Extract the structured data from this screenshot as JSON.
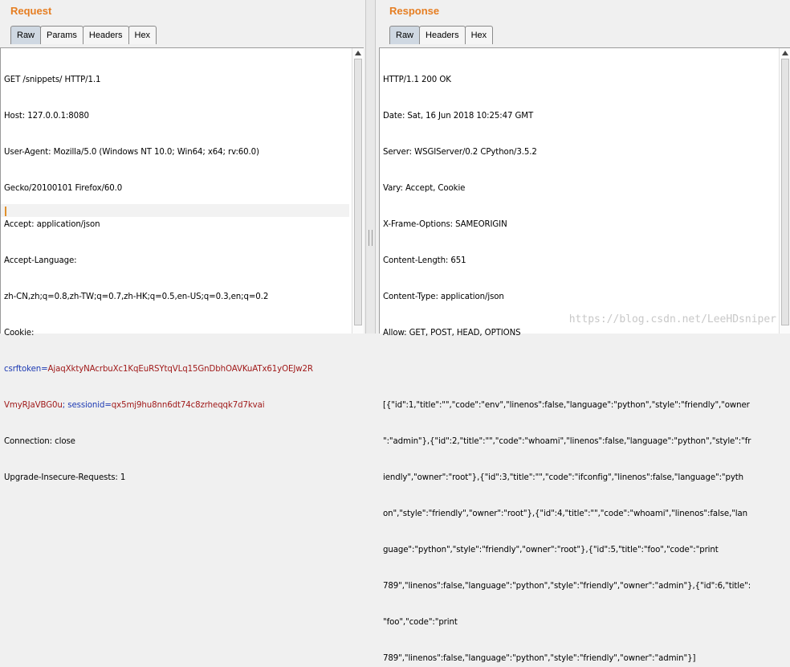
{
  "request": {
    "title": "Request",
    "tabs": [
      "Raw",
      "Params",
      "Headers",
      "Hex"
    ],
    "lines": [
      "GET /snippets/ HTTP/1.1",
      "Host: 127.0.0.1:8080",
      "User-Agent: Mozilla/5.0 (Windows NT 10.0; Win64; x64; rv:60.0)",
      "Gecko/20100101 Firefox/60.0",
      "Accept: application/json",
      "Accept-Language:",
      "zh-CN,zh;q=0.8,zh-TW;q=0.7,zh-HK;q=0.5,en-US;q=0.3,en;q=0.2",
      "Cookie:"
    ],
    "cookie": {
      "csrf_name": "csrftoken",
      "csrf_value_1": "AjaqXktyNAcrbuXc1KqEuRSYtqVLq15GnDbhOAVKuATx61yOEJw2R",
      "csrf_value_2": "VmyRJaVBG0u",
      "session_name": "sessionid",
      "session_value": "qx5mj9hu8nn6dt74c8zrheqqk7d7kvai"
    },
    "after_lines": [
      "Connection: close",
      "Upgrade-Insecure-Requests: 1"
    ]
  },
  "response": {
    "title": "Response",
    "tabs": [
      "Raw",
      "Headers",
      "Hex"
    ],
    "lines": [
      "HTTP/1.1 200 OK",
      "Date: Sat, 16 Jun 2018 10:25:47 GMT",
      "Server: WSGIServer/0.2 CPython/3.5.2",
      "Vary: Accept, Cookie",
      "X-Frame-Options: SAMEORIGIN",
      "Content-Length: 651",
      "Content-Type: application/json",
      "Allow: GET, POST, HEAD, OPTIONS",
      "",
      "[{\"id\":1,\"title\":\"\",\"code\":\"env\",\"linenos\":false,\"language\":\"python\",\"style\":\"friendly\",\"owner",
      "\":\"admin\"},{\"id\":2,\"title\":\"\",\"code\":\"whoami\",\"linenos\":false,\"language\":\"python\",\"style\":\"fr",
      "iendly\",\"owner\":\"root\"},{\"id\":3,\"title\":\"\",\"code\":\"ifconfig\",\"linenos\":false,\"language\":\"pyth",
      "on\",\"style\":\"friendly\",\"owner\":\"root\"},{\"id\":4,\"title\":\"\",\"code\":\"whoami\",\"linenos\":false,\"lan",
      "guage\":\"python\",\"style\":\"friendly\",\"owner\":\"root\"},{\"id\":5,\"title\":\"foo\",\"code\":\"print",
      "789\",\"linenos\":false,\"language\":\"python\",\"style\":\"friendly\",\"owner\":\"admin\"},{\"id\":6,\"title\":",
      "\"foo\",\"code\":\"print",
      "789\",\"linenos\":false,\"language\":\"python\",\"style\":\"friendly\",\"owner\":\"admin\"}]"
    ]
  },
  "watermark": "https://blog.csdn.net/LeeHDsniper",
  "colors": {
    "title": "#e67e22",
    "cookie_name": "#1d3ab3",
    "cookie_value": "#a01a1a"
  }
}
